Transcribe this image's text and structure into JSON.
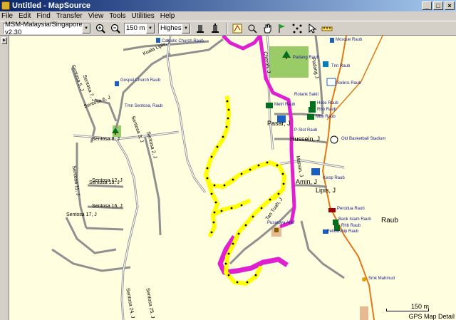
{
  "window": {
    "title": "Untitled - MapSource"
  },
  "menu": [
    "File",
    "Edit",
    "Find",
    "Transfer",
    "View",
    "Tools",
    "Utilities",
    "Help"
  ],
  "toolbar": {
    "map_product": "MSM-Malaysia/Singapore v2.30",
    "zoom": "150 m",
    "detail": "Highest"
  },
  "map": {
    "poi": {
      "catholic_church": "Catholic Church Raub",
      "mosque": "Mosque Raub",
      "padang": "Padang Raub",
      "tnn": "Tnn Raub",
      "gospel": "Gospel Church Raub",
      "selinis": "Selinis Raub",
      "tmn_sentosa": "Tmn Sentosa, Raub",
      "rotank_sakti": "Rotank Sakti",
      "metri": "Metri Raub",
      "hlsb": "Hsbc Raub",
      "rhb": "Rhb Raub",
      "mbb": "Mbb Raub",
      "old_stadium": "Old Basketball Stadium",
      "ps_raub": "P-Slot Raub",
      "bank_raub": "Bank Raub",
      "kwsp": "Kwsp Raub",
      "perodua": "Perodua Raub",
      "bank_islam": "Bank Islam Raub",
      "rhb2": "Rhb Raub",
      "fellowship": "Fellowship Raub",
      "pusaroya": "Pusaroya Ahlif",
      "smk": "Smk Mahmud"
    },
    "roads": {
      "kuala_lipis": "Kuala Lipis, J",
      "sentosa5": "Sentosa 5, J",
      "sentosa7": "Sentosa 7, J",
      "sentosa6": "Sentosa 6, J",
      "sentosa3": "Sentosa 3, J",
      "sentosa8": "Sentosa 8, J",
      "sentosa2": "Sentosa 2, J",
      "sentosa12": "Sentosa 12, J",
      "sentosa11": "Sentosa 11, J",
      "sentosa13": "Sentosa 13, J",
      "sentosa16": "Sentosa 16, J",
      "sentosa17": "Sentosa 17, J",
      "sentosa24": "Sentosa 24, J",
      "sentosa25": "Sentosa 25, J",
      "cheroh": "Cheroh, J",
      "padang": "Padang J",
      "pasar": "Pasar, J",
      "hussein": "Hussein, J",
      "mahsin": "Mahsin, J",
      "amin": "Amin, J",
      "lipis": "Lipis, J",
      "tun_tuah": "Tan Tuah, J"
    },
    "town": "Raub",
    "scale_label": "150 m",
    "status_label": "GPS Map Detail"
  },
  "colors": {
    "map_bg": "#ffffe0",
    "road": "#909090",
    "route": "#e020d0",
    "track": "#ffff00",
    "park": "#99cc66",
    "highway": "#e07818"
  }
}
